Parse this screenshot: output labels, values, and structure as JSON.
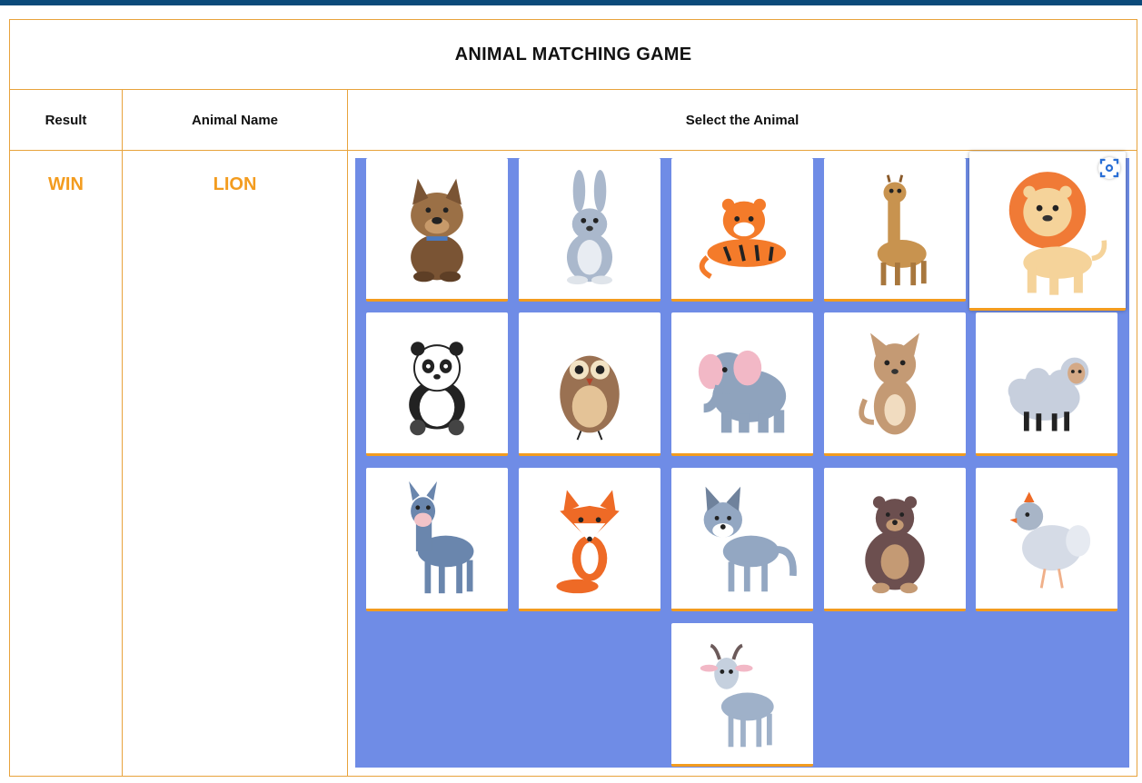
{
  "game": {
    "title": "ANIMAL MATCHING GAME",
    "headers": {
      "result": "Result",
      "animal_name": "Animal Name",
      "select": "Select the Animal"
    },
    "result_value": "WIN",
    "animal_name_value": "LION",
    "selected_animal": "lion"
  },
  "animals": [
    "dog",
    "rabbit",
    "tiger",
    "giraffe",
    "lion",
    "panda",
    "owl",
    "elephant",
    "cat",
    "sheep",
    "donkey",
    "fox",
    "wolf",
    "bear",
    "chicken",
    "goat"
  ],
  "colors": {
    "accent": "#f39c1f",
    "border": "#e8a33c",
    "grid_background": "#6f8ce6",
    "topbar": "#0b4a7a"
  },
  "icons": {
    "zoom": "zoom-scan-icon"
  }
}
